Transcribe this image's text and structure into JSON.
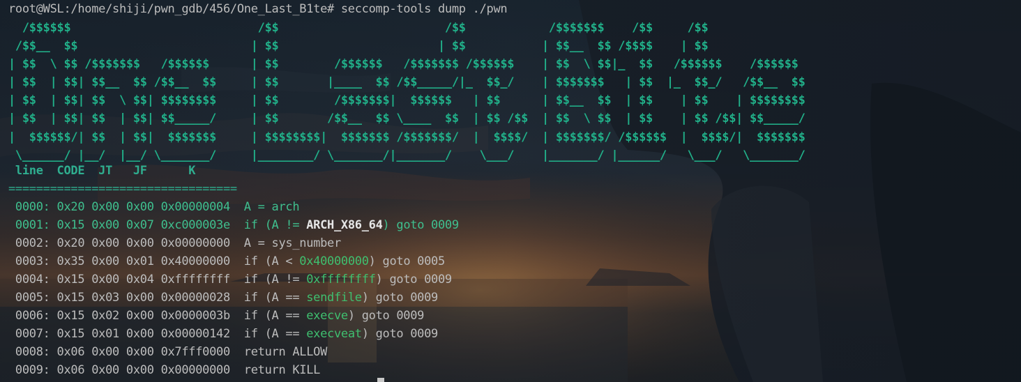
{
  "prompt_line": "root@WSL:/home/shiji/pwn_gdb/456/One_Last_B1te# seccomp-tools dump ./pwn",
  "banner_lines": [
    "  /$$$$$$                           /$$                        /$$            /$$$$$$$    /$$     /$$",
    " /$$__  $$                         | $$                       | $$           | $$__  $$ /$$$$    | $$",
    "| $$  \\ $$ /$$$$$$$   /$$$$$$      | $$        /$$$$$$   /$$$$$$$ /$$$$$$    | $$  \\ $$|_  $$   /$$$$$$    /$$$$$$",
    "| $$  | $$| $$__  $$ /$$__  $$     | $$       |____  $$ /$$_____/|_  $$_/    | $$$$$$$   | $$  |_  $$_/   /$$__  $$",
    "| $$  | $$| $$  \\ $$| $$$$$$$$     | $$        /$$$$$$$|  $$$$$$   | $$      | $$__  $$  | $$    | $$    | $$$$$$$$",
    "| $$  | $$| $$  | $$| $$_____/     | $$       /$$__  $$ \\____  $$  | $$ /$$  | $$  \\ $$  | $$    | $$ /$$| $$_____/",
    "|  $$$$$$/| $$  | $$|  $$$$$$$     | $$$$$$$$|  $$$$$$$ /$$$$$$$/  |  $$$$/  | $$$$$$$/ /$$$$$$  |  $$$$/|  $$$$$$$",
    " \\______/ |__/  |__/ \\_______/     |________/ \\_______/|_______/    \\___/    |_______/ |______/   \\___/   \\_______/"
  ],
  "table_header": " line  CODE  JT   JF      K",
  "separator": "=================================",
  "rows": [
    {
      "addr": "0000: 0x20 0x00 0x00 0x00000004",
      "pre": "A = arch",
      "hl": "",
      "post": ""
    },
    {
      "addr": "0001: 0x15 0x00 0x07 0xc000003e",
      "pre": "if (A != ",
      "hl": "ARCH_X86_64",
      "post": ") goto 0009"
    },
    {
      "addr": "0002: 0x20 0x00 0x00 0x00000000",
      "pre": "A = sys_number",
      "hl": "",
      "post": ""
    },
    {
      "addr": "0003: 0x35 0x00 0x01 0x40000000",
      "pre": "if (A < ",
      "hl": "0x40000000",
      "post": ") goto 0005"
    },
    {
      "addr": "0004: 0x15 0x00 0x04 0xffffffff",
      "pre": "if (A != ",
      "hl": "0xffffffff",
      "post": ") goto 0009"
    },
    {
      "addr": "0005: 0x15 0x03 0x00 0x00000028",
      "pre": "if (A == ",
      "hl": "sendfile",
      "post": ") goto 0009"
    },
    {
      "addr": "0006: 0x15 0x02 0x00 0x0000003b",
      "pre": "if (A == ",
      "hl": "execve",
      "post": ") goto 0009"
    },
    {
      "addr": "0007: 0x15 0x01 0x00 0x00000142",
      "pre": "if (A == ",
      "hl": "execveat",
      "post": ") goto 0009"
    },
    {
      "addr": "0008: 0x06 0x00 0x00 0x7fff0000",
      "pre": "return ALLOW",
      "hl": "",
      "post": ""
    },
    {
      "addr": "0009: 0x06 0x00 0x00 0x00000000",
      "pre": "return KILL",
      "hl": "",
      "post": ""
    }
  ],
  "colors": {
    "banner": "#21b089",
    "highlight_green": "#3fbf6f",
    "text": "#bcbcbc"
  }
}
